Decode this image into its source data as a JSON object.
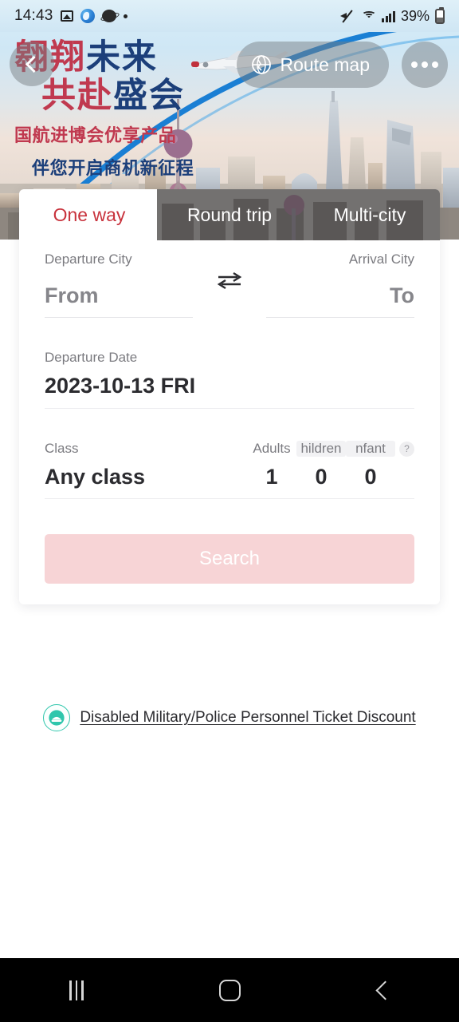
{
  "status_bar": {
    "time": "14:43",
    "battery_percent": "39%",
    "icons": [
      "photo-icon",
      "globe-app-icon",
      "planet-app-icon",
      "dot-icon",
      "mute-icon",
      "wifi-icon",
      "signal-icon",
      "battery-icon"
    ]
  },
  "hero": {
    "headline_line1_red": "翱翔",
    "headline_line1_blue": "未来",
    "headline_line2_red": "共赴",
    "headline_line2_blue": "盛会",
    "subline1": "国航进博会优享产品",
    "subline2": "伴您开启商机新征程",
    "back_label": "back-chevron",
    "route_map_label": "Route map",
    "more_label": "more-options"
  },
  "tabs": [
    {
      "label": "One way",
      "active": true
    },
    {
      "label": "Round trip",
      "active": false
    },
    {
      "label": "Multi-city",
      "active": false
    }
  ],
  "form": {
    "departure_city_label": "Departure City",
    "departure_city_value": "From",
    "arrival_city_label": "Arrival City",
    "arrival_city_value": "To",
    "swap_icon": "swap-arrows-icon",
    "departure_date_label": "Departure Date",
    "departure_date_value": "2023-10-13 FRI",
    "class_label": "Class",
    "class_value": "Any class",
    "passengers": [
      {
        "label": "Adults",
        "value": "1",
        "clipped": false
      },
      {
        "label": "hildren",
        "value": "0",
        "clipped": true
      },
      {
        "label": "nfant",
        "value": "0",
        "clipped": true
      }
    ],
    "help_badge": "?",
    "search_label": "Search"
  },
  "discount": {
    "icon": "military-police-cap-icon",
    "text": "Disabled Military/Police Personnel Ticket Discount"
  },
  "nav_bar": {
    "recents": "recents-button",
    "home": "home-button",
    "back": "back-button"
  },
  "colors": {
    "accent_red": "#c8323c",
    "headline_blue": "#1c3f7a",
    "search_disabled_bg": "#f7d4d6",
    "discount_teal": "#2fc6ac"
  }
}
